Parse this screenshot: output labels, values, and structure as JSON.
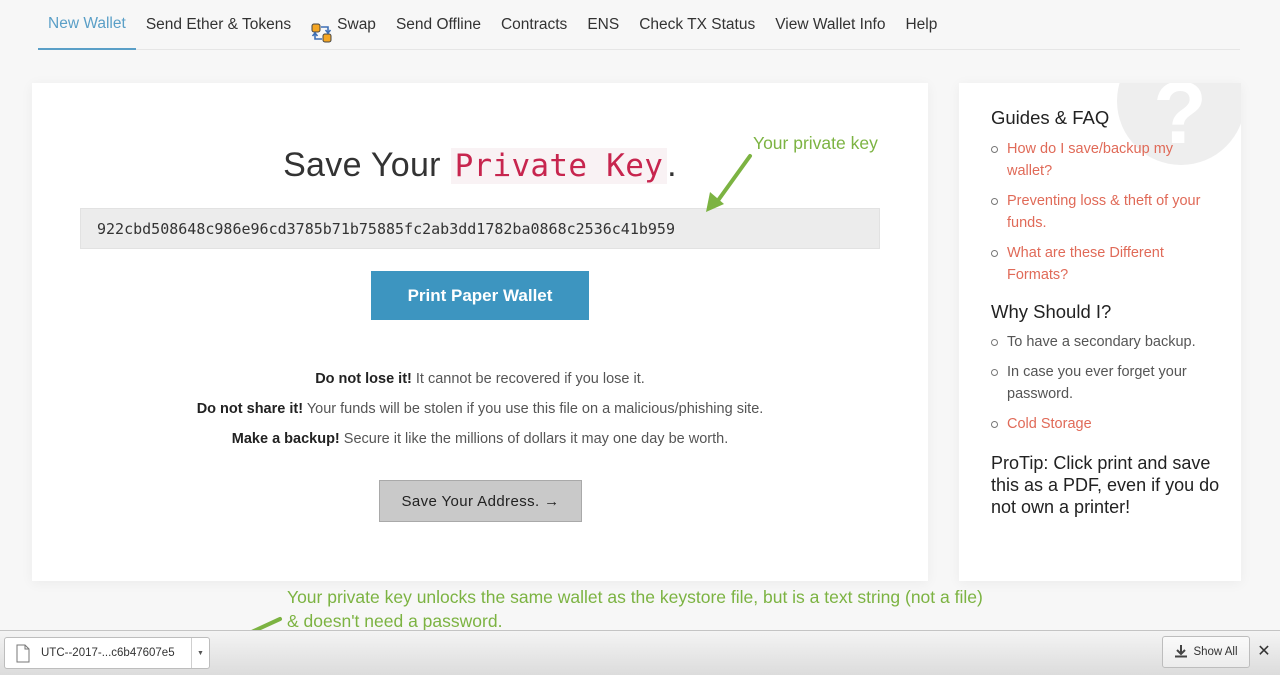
{
  "nav": {
    "items": [
      {
        "label": "New Wallet",
        "active": true
      },
      {
        "label": "Send Ether & Tokens"
      },
      {
        "label": "Swap",
        "icon": "swap-icon"
      },
      {
        "label": "Send Offline"
      },
      {
        "label": "Contracts"
      },
      {
        "label": "ENS"
      },
      {
        "label": "Check TX Status"
      },
      {
        "label": "View Wallet Info"
      },
      {
        "label": "Help"
      }
    ]
  },
  "main": {
    "title_prefix": "Save Your ",
    "title_code": "Private Key",
    "title_suffix": ".",
    "private_key": "922cbd508648c986e96cd3785b71b75885fc2ab3dd1782ba0868c2536c41b959",
    "print_button": "Print Paper Wallet",
    "warnings": [
      {
        "bold": "Do not lose it!",
        "text": " It cannot be recovered if you lose it."
      },
      {
        "bold": "Do not share it!",
        "text": " Your funds will be stolen if you use this file on a malicious/phishing site."
      },
      {
        "bold": "Make a backup!",
        "text": " Secure it like the millions of dollars it may one day be worth."
      }
    ],
    "save_button": "Save Your Address. →"
  },
  "sidebar": {
    "guides_heading": "Guides & FAQ",
    "guides": [
      "How do I save/backup my wallet?",
      "Preventing loss & theft of your funds.",
      "What are these Different Formats?"
    ],
    "why_heading": "Why Should I?",
    "why": [
      {
        "text": "To have a secondary backup.",
        "link": false
      },
      {
        "text": "In case you ever forget your password.",
        "link": false
      },
      {
        "text": "Cold Storage",
        "link": true
      }
    ],
    "protip": "ProTip: Click print and save this as a PDF, even if you do not own a printer!",
    "question_mark": "?"
  },
  "annotations": {
    "top": "Your private key",
    "bottom_line1": "Your private key unlocks the same wallet as the keystore file, but is a text string (not a file)",
    "bottom_line2": "& doesn't need a password."
  },
  "download_bar": {
    "file_name": "UTC--2017-...c6b47607e5",
    "show_all": "Show All",
    "close": "✕"
  },
  "colors": {
    "accent": "#5a9fc7",
    "primary_button": "#3d95c0",
    "link": "#e06a58",
    "annotation": "#7cb342",
    "code": "#c7254e"
  }
}
